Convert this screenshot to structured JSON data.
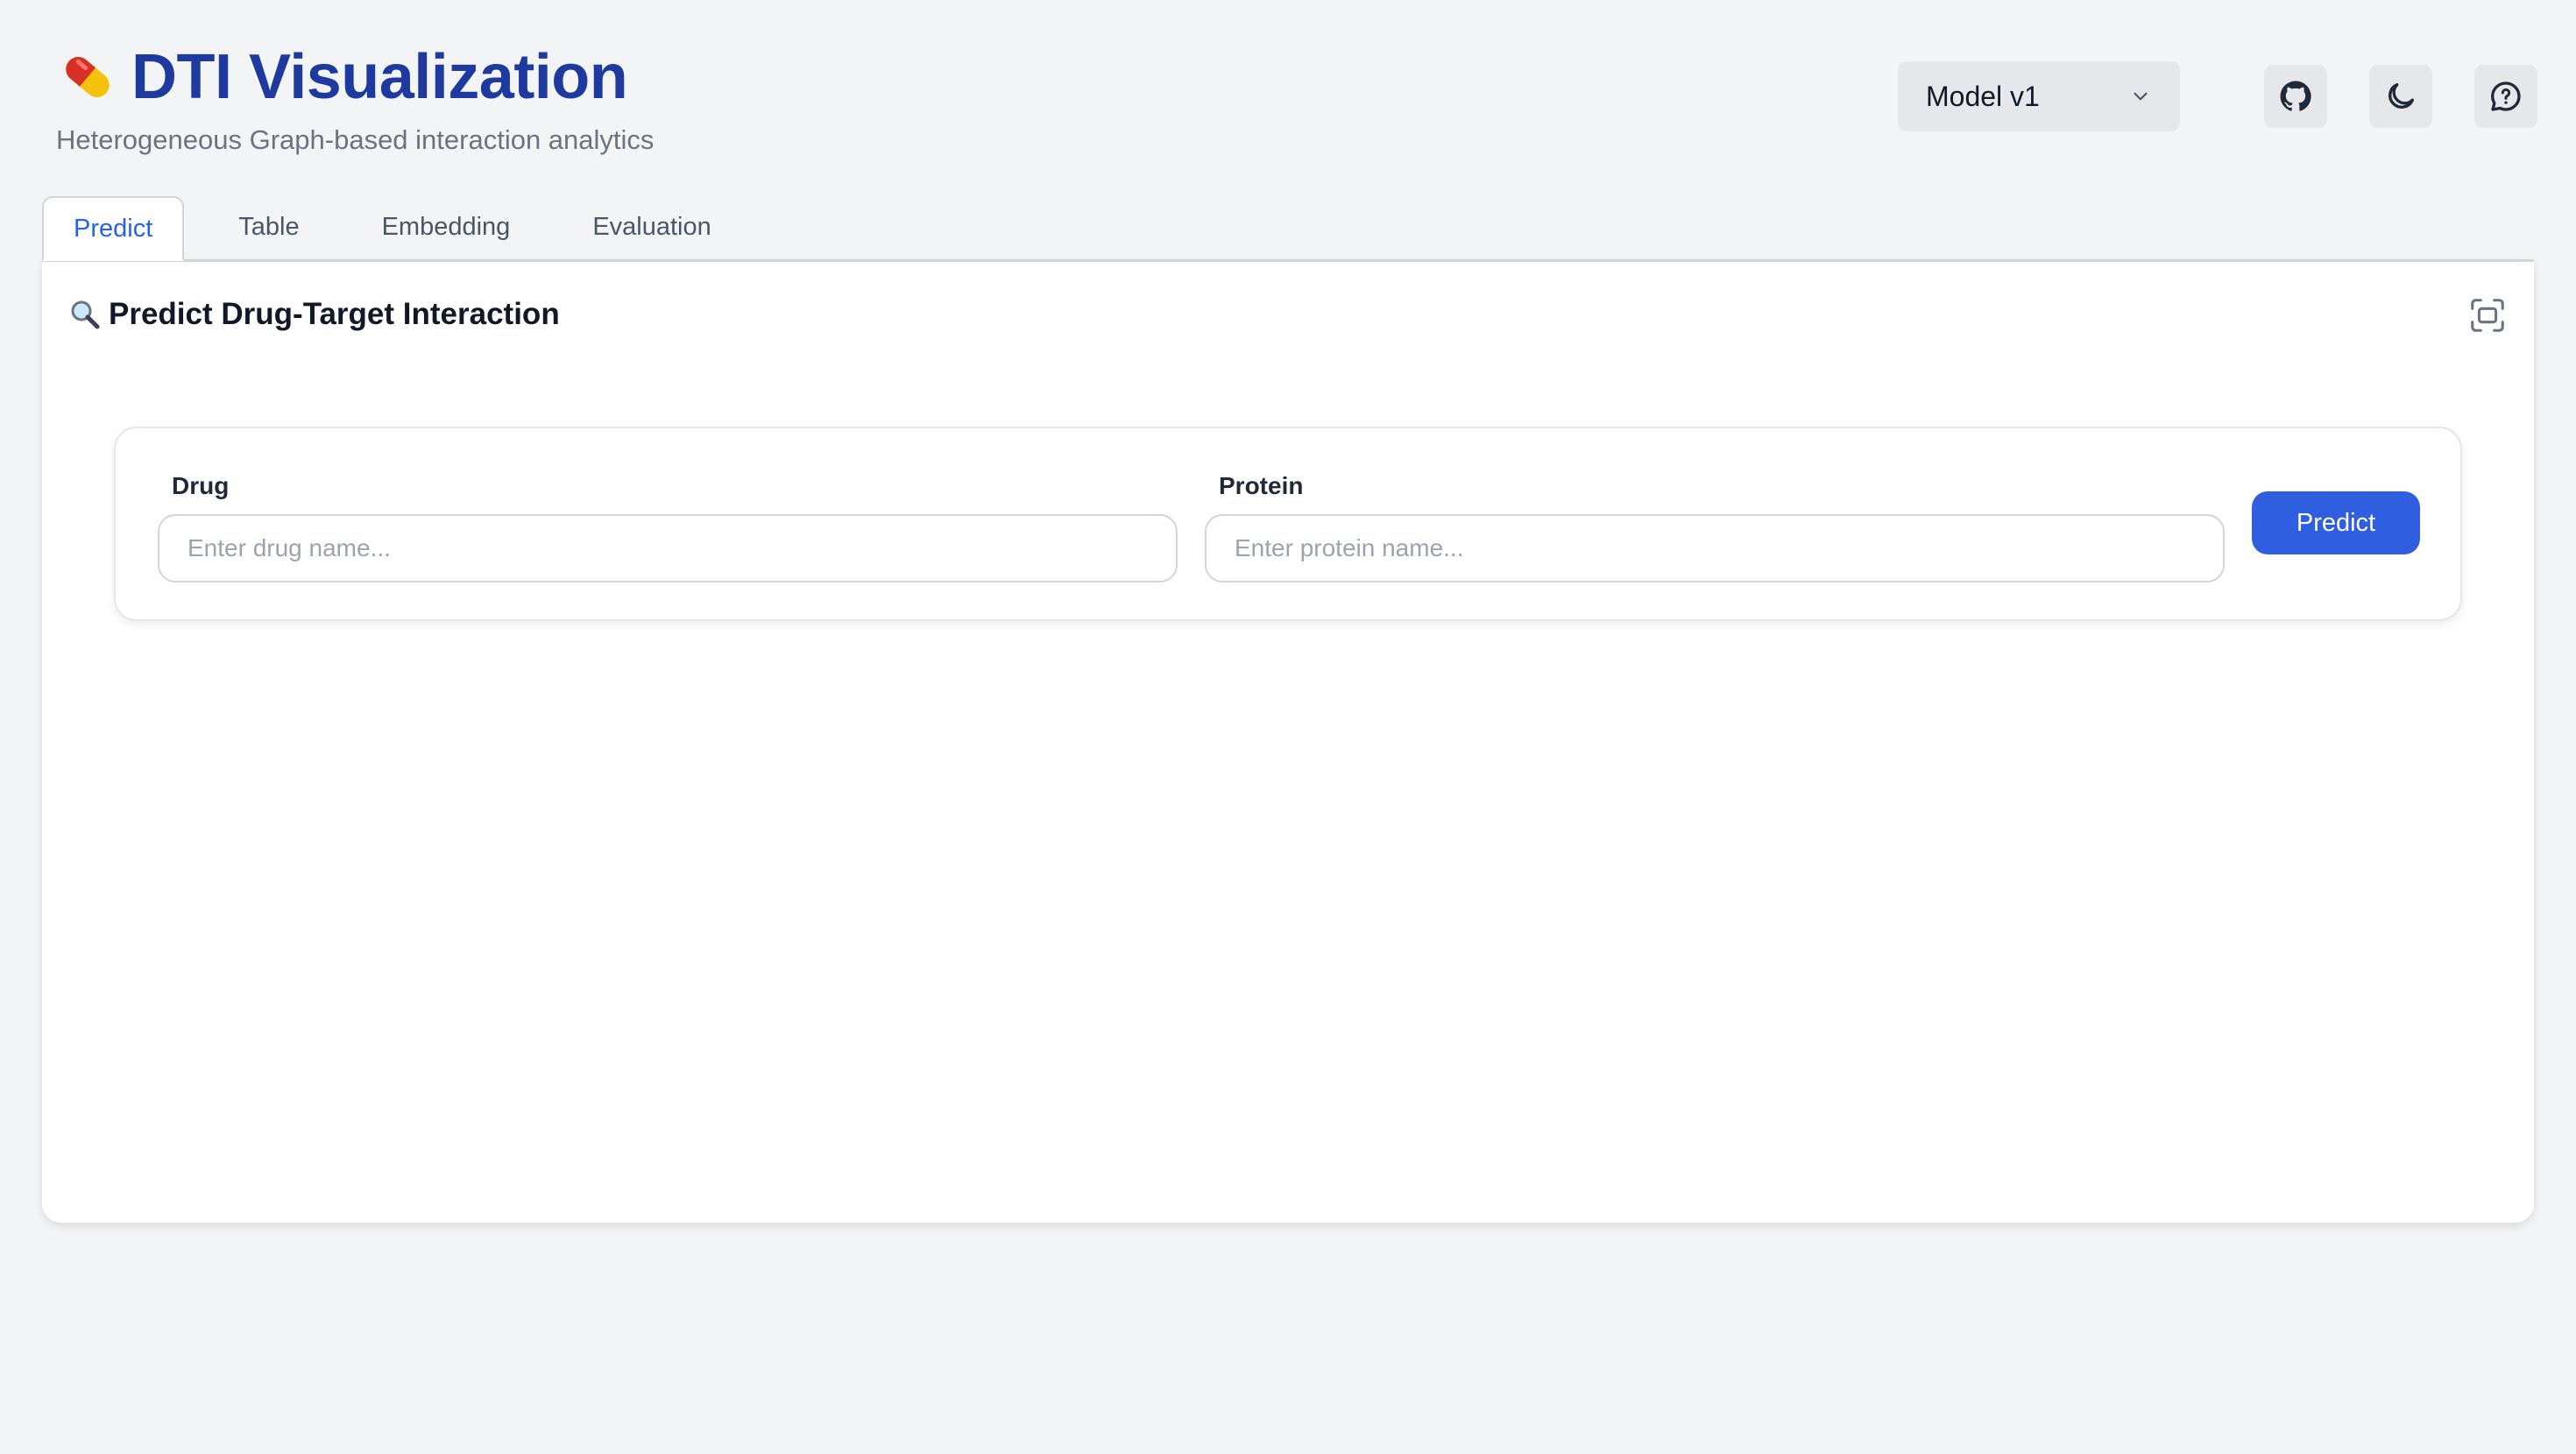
{
  "header": {
    "icon": "pill-icon",
    "title": "DTI Visualization",
    "subtitle": "Heterogeneous Graph-based interaction analytics"
  },
  "controls": {
    "model_select": {
      "selected": "Model v1"
    },
    "buttons": [
      {
        "icon": "github-icon"
      },
      {
        "icon": "moon-icon"
      },
      {
        "icon": "feedback-chat-icon"
      }
    ]
  },
  "tabs": [
    {
      "label": "Predict",
      "active": true
    },
    {
      "label": "Table",
      "active": false
    },
    {
      "label": "Embedding",
      "active": false
    },
    {
      "label": "Evaluation",
      "active": false
    }
  ],
  "panel": {
    "title": "Predict Drug-Target Interaction",
    "title_icon": "magnifier-icon",
    "expand_icon": "fullscreen-icon"
  },
  "form": {
    "drug": {
      "label": "Drug",
      "placeholder": "Enter drug name...",
      "value": ""
    },
    "protein": {
      "label": "Protein",
      "placeholder": "Enter protein name...",
      "value": ""
    },
    "submit_label": "Predict"
  },
  "colors": {
    "accent": "#2f5fe0",
    "title": "#1e3a9f",
    "background": "#f3f4f6"
  }
}
